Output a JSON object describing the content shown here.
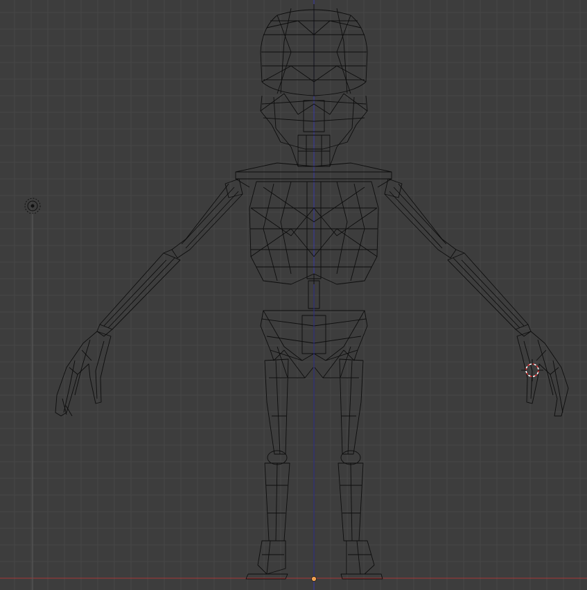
{
  "viewport": {
    "mode": "wireframe",
    "view": "front-orthographic",
    "background_color": "#3d3d3d",
    "grid_color": "#474747",
    "wire_color": "#0c0c0c",
    "x_axis_color": "#b03a3a",
    "z_axis_color": "#3a3ab0",
    "origin_dot_color": "#f0a050",
    "cursor_ring_color": "#e03030",
    "object": "skeleton-character-mesh",
    "has_lamp": true,
    "has_3d_cursor": true
  }
}
